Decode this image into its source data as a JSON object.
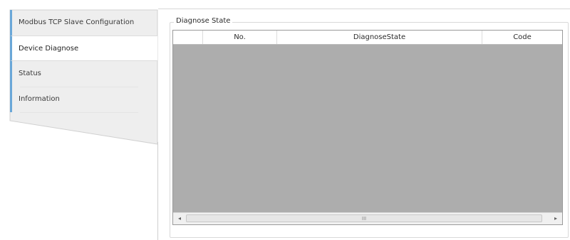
{
  "nav": {
    "items": [
      {
        "label": "Modbus TCP Slave Configuration",
        "active": false
      },
      {
        "label": "Device Diagnose",
        "active": true
      },
      {
        "label": "Status",
        "active": false
      },
      {
        "label": "Information",
        "active": false
      }
    ]
  },
  "diagnose": {
    "group_title": "Diagnose State",
    "columns": [
      "No.",
      "DiagnoseState",
      "Code"
    ],
    "rows": [],
    "scrollbar": {
      "left_arrow": "◂",
      "right_arrow": "▸",
      "grip": "III"
    }
  },
  "colors": {
    "grid_body": "#adadad",
    "nav_background": "#eeeeee",
    "accent": "#6aa7d8"
  }
}
